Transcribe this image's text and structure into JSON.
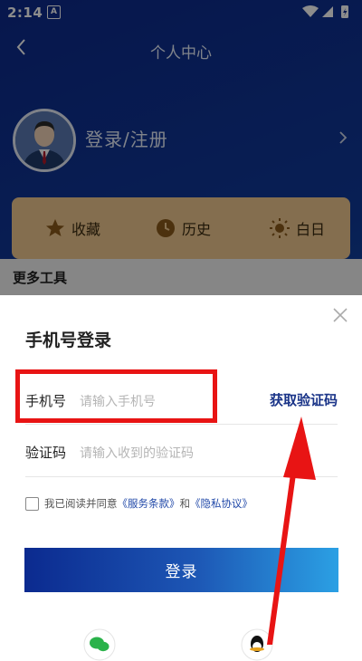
{
  "status_bar": {
    "time": "2:14",
    "icon_a": "A",
    "icons": [
      "notification-icon",
      "wifi-icon",
      "signal-icon",
      "battery-charging-icon"
    ]
  },
  "header": {
    "title": "个人中心",
    "back_icon": "chevron-left-icon"
  },
  "profile": {
    "avatar_icon": "user-avatar-icon",
    "login_register": "登录/注册",
    "chevron": "chevron-right-icon"
  },
  "quick_actions": [
    {
      "label": "收藏",
      "icon": "star-icon"
    },
    {
      "label": "历史",
      "icon": "clock-icon"
    },
    {
      "label": "白日",
      "icon": "sun-icon"
    }
  ],
  "more_tools": "更多工具",
  "login_sheet": {
    "title": "手机号登录",
    "phone_label": "手机号",
    "phone_placeholder": "请输入手机号",
    "get_code": "获取验证码",
    "code_label": "验证码",
    "code_placeholder": "请输入收到的验证码",
    "agree_prefix": "我已阅读并同意",
    "service_terms": "《服务条款》",
    "and": "和",
    "privacy_policy": "《隐私协议》",
    "login_button": "登录",
    "close_icon": "close-icon"
  },
  "bottom_icons": [
    "wechat-icon",
    "qq-icon"
  ],
  "annotations": {
    "highlight_color": "#e81414",
    "arrow_color": "#e81414"
  },
  "colors": {
    "primary": "#0d2a8c",
    "accent": "#2ba0e4",
    "link": "#2048a8"
  }
}
